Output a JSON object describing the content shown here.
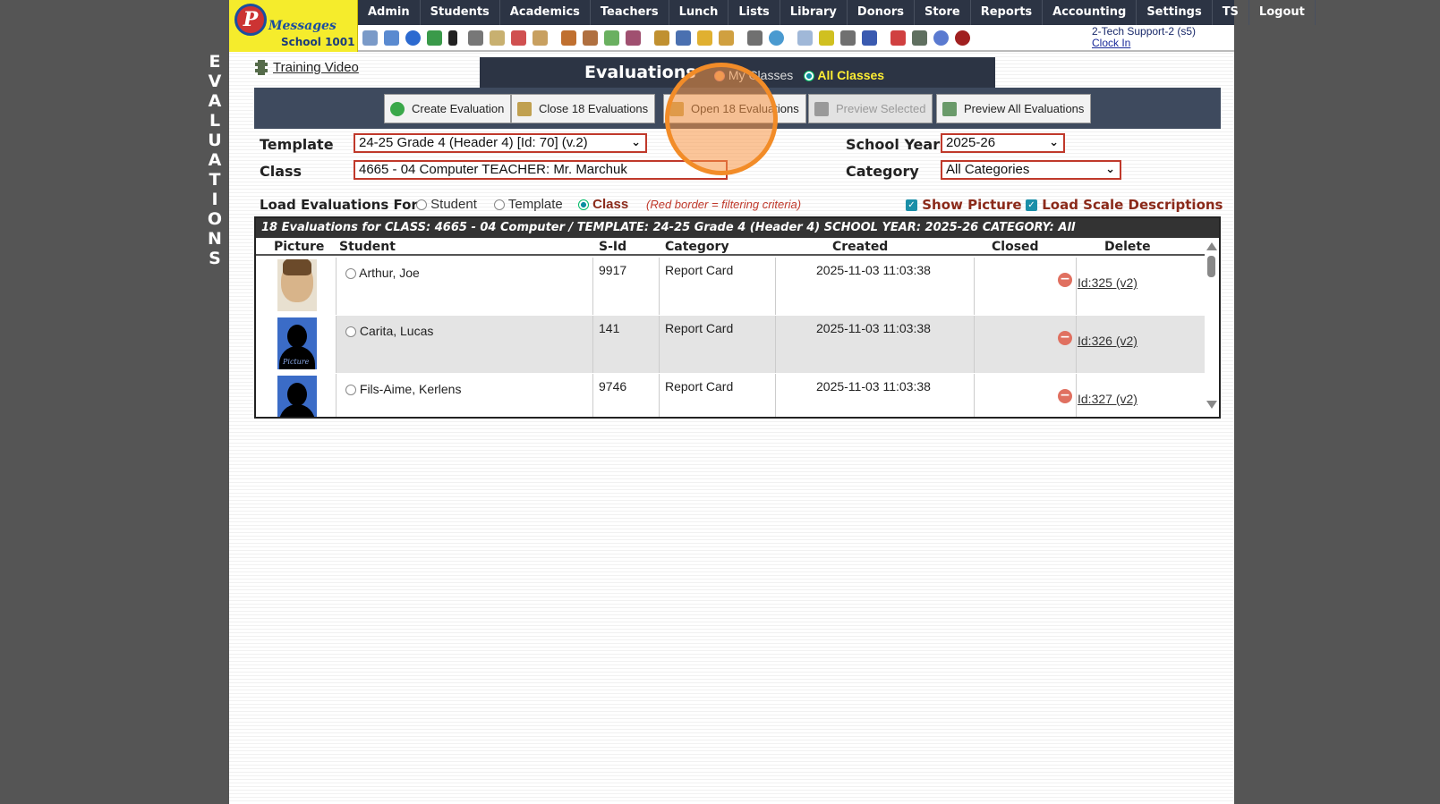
{
  "side_title": [
    "E",
    "V",
    "A",
    "L",
    "U",
    "A",
    "T",
    "I",
    "O",
    "N",
    "S"
  ],
  "logo": {
    "letter": "P",
    "word": "Messages",
    "school": "School 1001"
  },
  "nav": [
    "Admin",
    "Students",
    "Academics",
    "Teachers",
    "Lunch",
    "Lists",
    "Library",
    "Donors",
    "Store",
    "Reports",
    "Accounting",
    "Settings",
    "TS",
    "Logout"
  ],
  "user": {
    "name": "2-Tech Support-2 (s5)",
    "clock": "Clock In"
  },
  "training_video": "Training Video",
  "eval_header": {
    "title": "Evaluations",
    "my_classes": "My Classes",
    "all_classes": "All Classes"
  },
  "buttons": {
    "create": "Create Evaluation",
    "close": "Close 18 Evaluations",
    "open": "Open 18 Evaluations",
    "preview_selected": "Preview Selected",
    "preview_all": "Preview All Evaluations"
  },
  "filters": {
    "template_label": "Template",
    "template_value": "24-25 Grade 4 (Header 4) [Id: 70] (v.2)",
    "class_label": "Class",
    "class_value": "4665 - 04 Computer TEACHER: Mr. Marchuk",
    "school_year_label": "School Year",
    "school_year_value": "2025-26",
    "category_label": "Category",
    "category_value": "All Categories"
  },
  "load_for": {
    "label": "Load Evaluations For",
    "student": "Student",
    "template": "Template",
    "class": "Class",
    "note": "(Red border = filtering criteria)",
    "show_picture": "Show Picture",
    "load_scale": "Load Scale Descriptions"
  },
  "table": {
    "caption": "18 Evaluations for CLASS: 4665 - 04 Computer /   TEMPLATE: 24-25 Grade 4 (Header 4)   SCHOOL YEAR: 2025-26 CATEGORY: All",
    "headers": [
      "Picture",
      "Student",
      "S-Id",
      "Category",
      "Created",
      "Closed",
      "Delete"
    ],
    "rows": [
      {
        "student": "Arthur, Joe",
        "sid": "9917",
        "category": "Report Card",
        "created": "2025-11-03 11:03:38",
        "closed": "",
        "delete": "Id:325 (v2)"
      },
      {
        "student": "Carita, Lucas",
        "sid": "141",
        "category": "Report Card",
        "created": "2025-11-03 11:03:38",
        "closed": "",
        "delete": "Id:326 (v2)"
      },
      {
        "student": "Fils-Aime, Kerlens",
        "sid": "9746",
        "category": "Report Card",
        "created": "2025-11-03 11:03:38",
        "closed": "",
        "delete": "Id:327 (v2)"
      }
    ],
    "picture_label": "Picture"
  }
}
